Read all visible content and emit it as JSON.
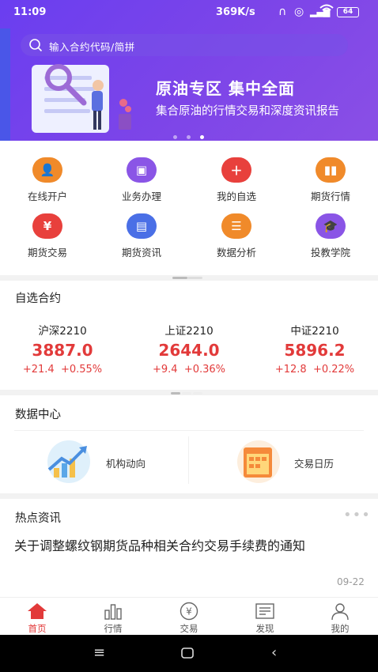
{
  "status_bar": {
    "time": "11:09",
    "network_speed": "369K/s",
    "battery": "64"
  },
  "search": {
    "placeholder": "输入合约代码/简拼"
  },
  "banner": {
    "title": "原油专区  集中全面",
    "subtitle": "集合原油的行情交易和深度资讯报告",
    "dot_count": 3,
    "active_dot": 2
  },
  "quick_menu": [
    {
      "label": "在线开户",
      "color": "#f08a2a",
      "icon": "person-add-icon"
    },
    {
      "label": "业务办理",
      "color": "#8a55e6",
      "icon": "briefcase-icon"
    },
    {
      "label": "我的自选",
      "color": "#e8403c",
      "icon": "plus-icon"
    },
    {
      "label": "期货行情",
      "color": "#f08a2a",
      "icon": "bar-chart-icon"
    },
    {
      "label": "期货交易",
      "color": "#e8403c",
      "icon": "yen-icon"
    },
    {
      "label": "期货资讯",
      "color": "#4a6fe6",
      "icon": "news-icon"
    },
    {
      "label": "数据分析",
      "color": "#f08a2a",
      "icon": "list-icon"
    },
    {
      "label": "投教学院",
      "color": "#8a55e6",
      "icon": "graduation-cap-icon"
    }
  ],
  "watchlist": {
    "title": "自选合约",
    "quotes": [
      {
        "name": "沪深2210",
        "price": "3887.0",
        "change": "+21.4",
        "pct": "+0.55%"
      },
      {
        "name": "上证2210",
        "price": "2644.0",
        "change": "+9.4",
        "pct": "+0.36%"
      },
      {
        "name": "中证2210",
        "price": "5896.2",
        "change": "+12.8",
        "pct": "+0.22%"
      }
    ]
  },
  "data_center": {
    "title": "数据中心",
    "items": [
      {
        "label": "机构动向"
      },
      {
        "label": "交易日历"
      }
    ]
  },
  "hot_news": {
    "title": "热点资讯",
    "items": [
      {
        "headline": "关于调整螺纹钢期货品种相关合约交易手续费的通知",
        "date": "09-22"
      }
    ]
  },
  "tabbar": [
    {
      "label": "首页",
      "active": true
    },
    {
      "label": "行情",
      "active": false
    },
    {
      "label": "交易",
      "active": false
    },
    {
      "label": "发现",
      "active": false
    },
    {
      "label": "我的",
      "active": false
    }
  ],
  "colors": {
    "brand_purple": "#7040ec",
    "up_red": "#e23a3a"
  }
}
